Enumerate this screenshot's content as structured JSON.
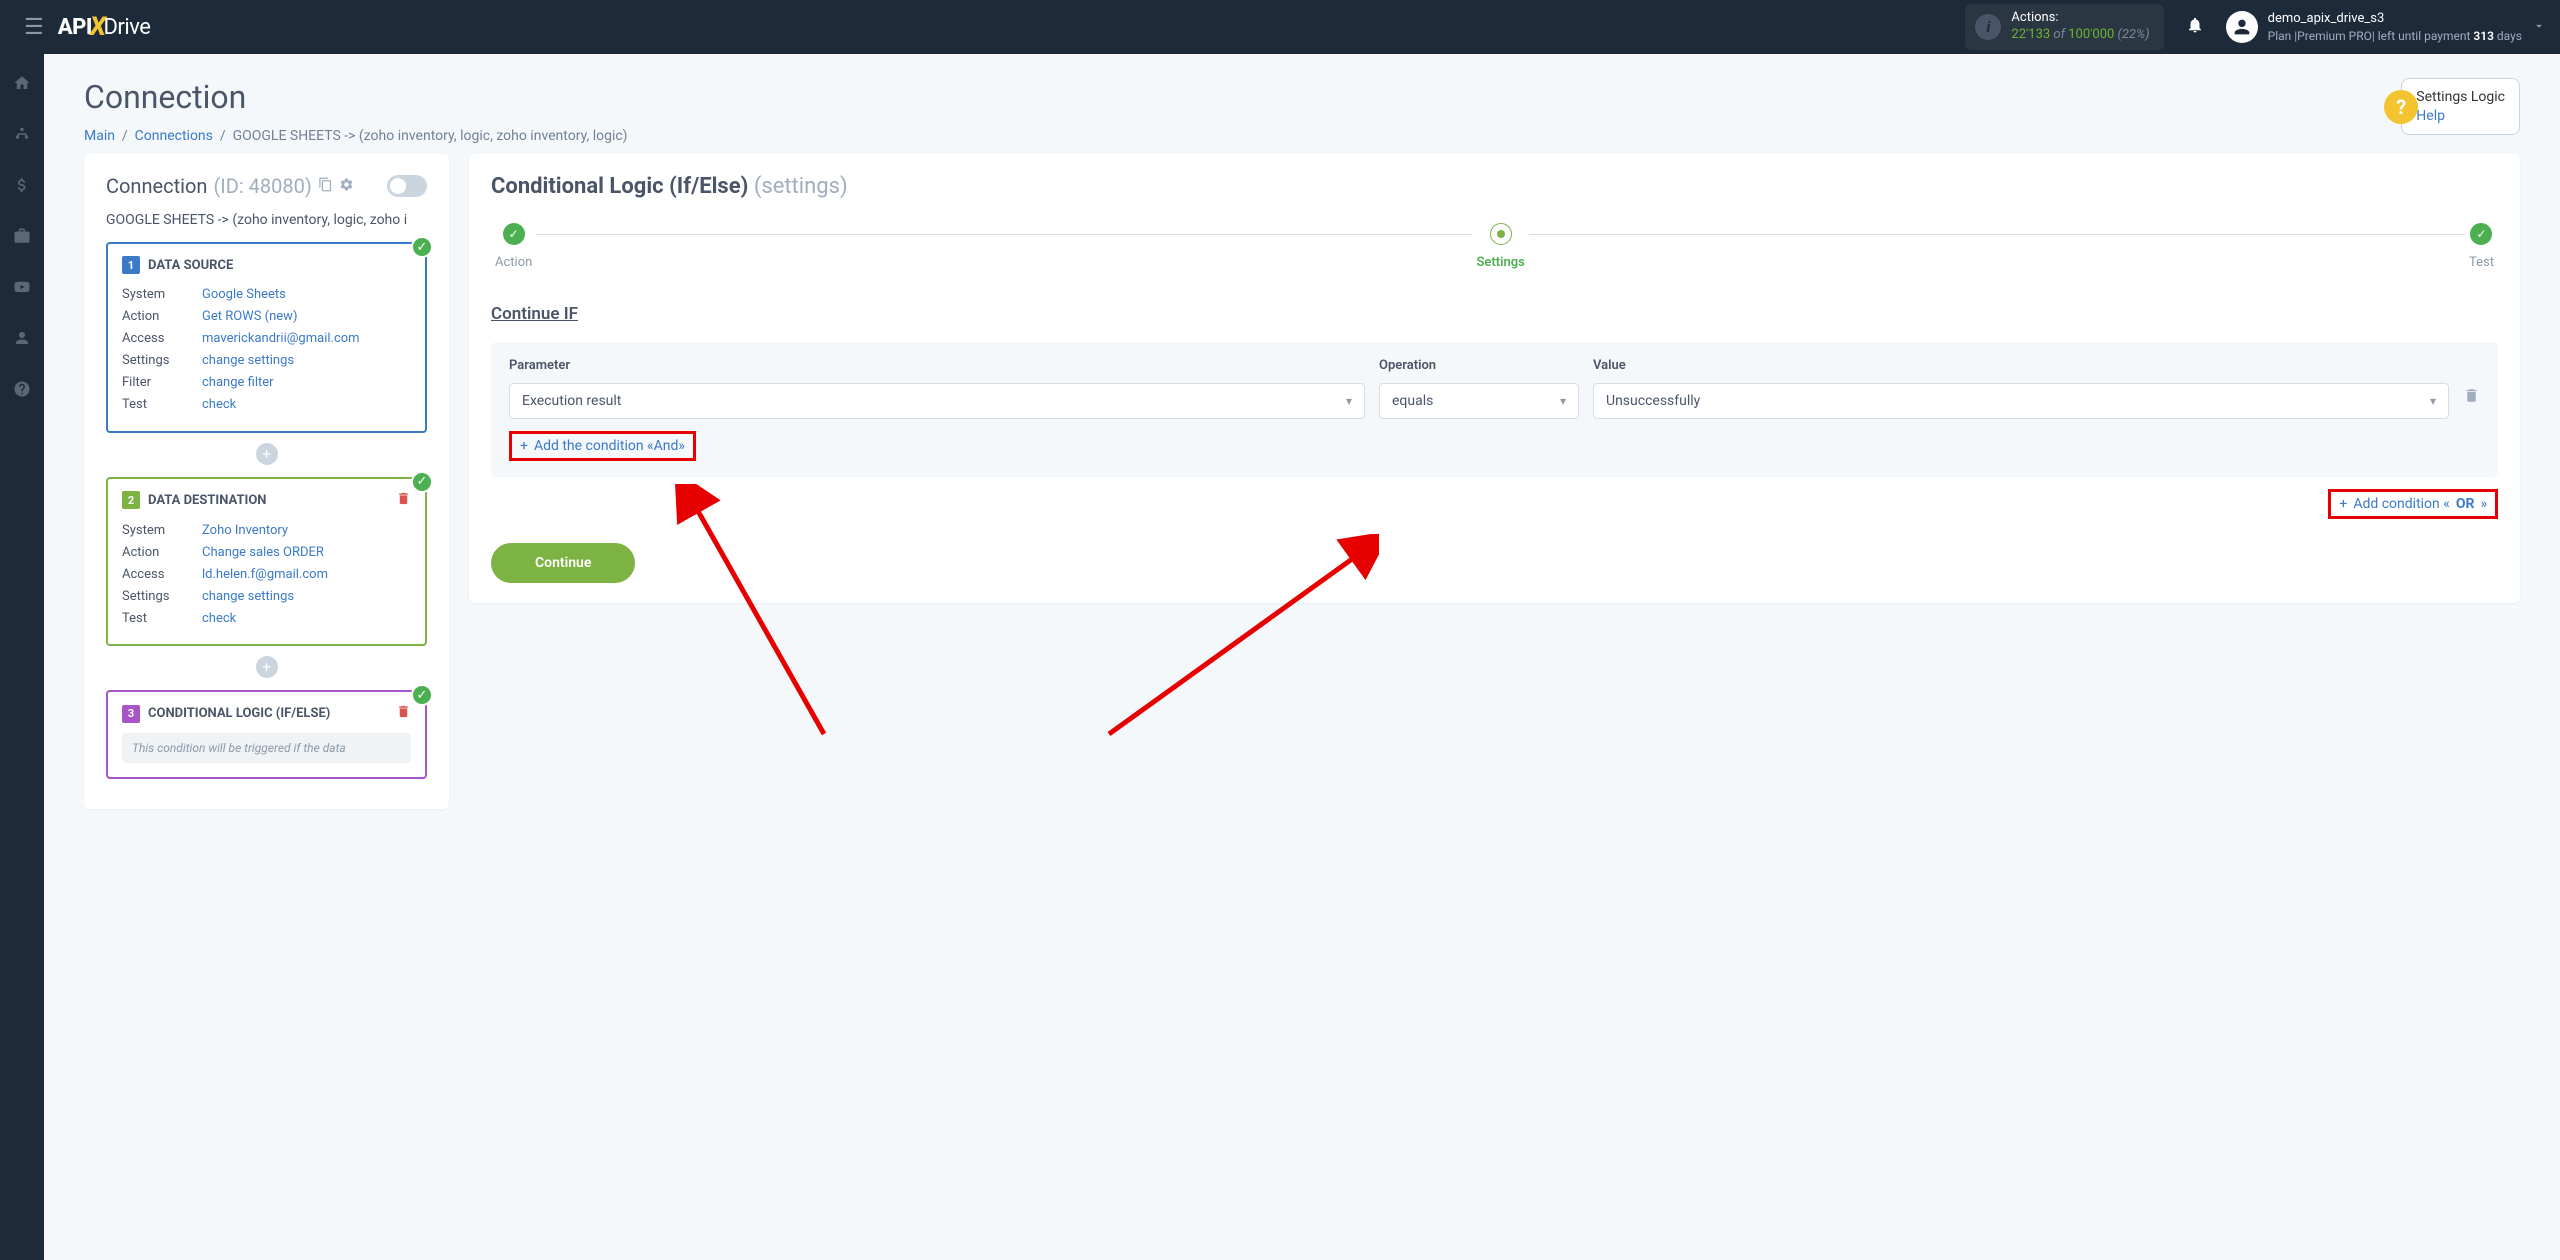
{
  "header": {
    "logo_api": "API",
    "logo_drive": "Drive",
    "actions_label": "Actions:",
    "actions_used": "22'133",
    "actions_of": " of ",
    "actions_total": "100'000",
    "actions_pct": " (22%)",
    "user_name": "demo_apix_drive_s3",
    "user_plan_prefix": "Plan |Premium PRO| left until payment ",
    "user_plan_days": "313",
    "user_plan_suffix": " days"
  },
  "page": {
    "title": "Connection",
    "breadcrumb_main": "Main",
    "breadcrumb_conns": "Connections",
    "breadcrumb_current": "GOOGLE SHEETS -> (zoho inventory, logic, zoho inventory, logic)",
    "help_title": "Settings Logic",
    "help_link": "Help"
  },
  "left": {
    "title": "Connection",
    "id_label": "(ID: 48080)",
    "path": "GOOGLE SHEETS -> (zoho inventory, logic, zoho i",
    "source": {
      "num": "1",
      "title": "DATA SOURCE",
      "rows": [
        {
          "label": "System",
          "value": "Google Sheets"
        },
        {
          "label": "Action",
          "value": "Get ROWS (new)"
        },
        {
          "label": "Access",
          "value": "maverickandrii@gmail.com"
        },
        {
          "label": "Settings",
          "value": "change settings"
        },
        {
          "label": "Filter",
          "value": "change filter"
        },
        {
          "label": "Test",
          "value": "check"
        }
      ]
    },
    "dest": {
      "num": "2",
      "title": "DATA DESTINATION",
      "rows": [
        {
          "label": "System",
          "value": "Zoho Inventory"
        },
        {
          "label": "Action",
          "value": "Change sales ORDER"
        },
        {
          "label": "Access",
          "value": "ld.helen.f@gmail.com"
        },
        {
          "label": "Settings",
          "value": "change settings"
        },
        {
          "label": "Test",
          "value": "check"
        }
      ]
    },
    "logic": {
      "num": "3",
      "title": "CONDITIONAL LOGIC (IF/ELSE)",
      "note": "This condition will be triggered if the data"
    }
  },
  "right": {
    "title": "Conditional Logic (If/Else) ",
    "subtitle": "(settings)",
    "steps": {
      "action": "Action",
      "settings": "Settings",
      "test": "Test"
    },
    "continue_if": "Continue IF",
    "labels": {
      "parameter": "Parameter",
      "operation": "Operation",
      "value": "Value"
    },
    "values": {
      "parameter": "Execution result",
      "operation": "equals",
      "value": "Unsuccessfully"
    },
    "add_and": "Add the condition «And»",
    "add_or_prefix": "Add condition «",
    "add_or_bold": "OR",
    "add_or_suffix": "»",
    "continue_btn": "Continue"
  }
}
